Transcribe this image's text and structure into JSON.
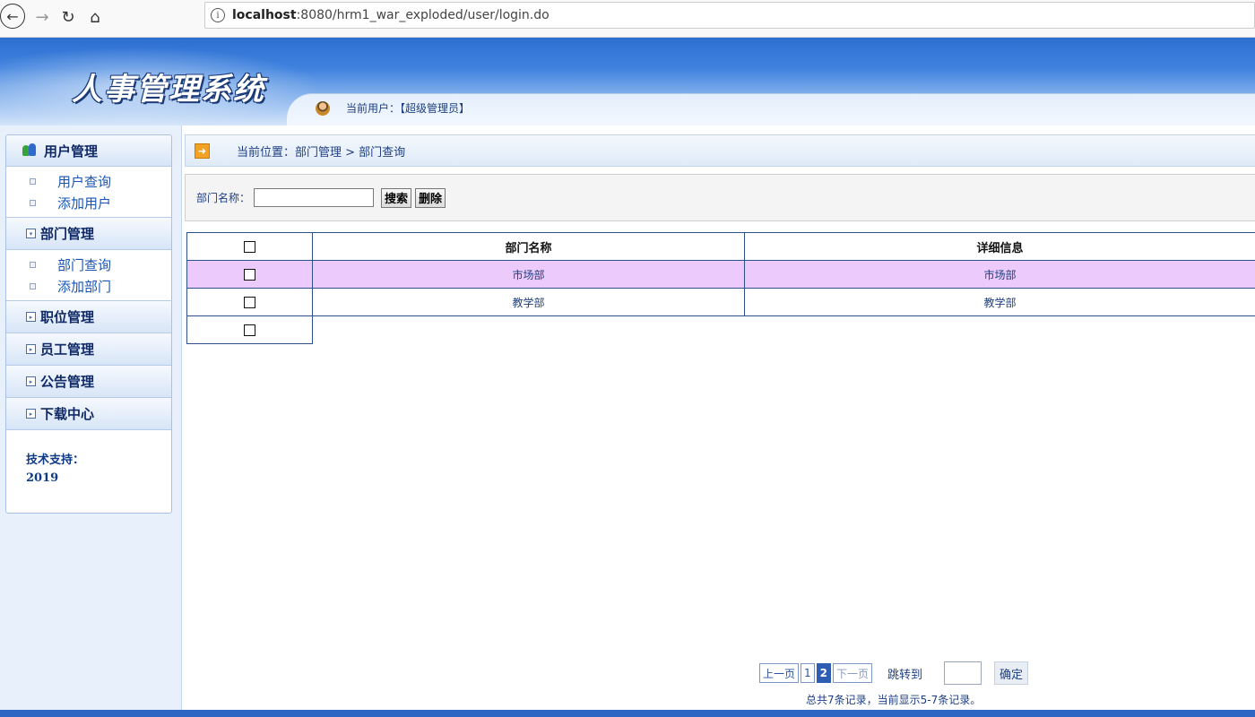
{
  "browser": {
    "url_host": "localhost",
    "url_path": ":8080/hrm1_war_exploded/user/login.do"
  },
  "header": {
    "app_title": "人事管理系统",
    "current_user": "当前用户：【超级管理员】"
  },
  "sidebar": {
    "groups": [
      {
        "label": "用户管理",
        "items": [
          "用户查询",
          "添加用户"
        ]
      },
      {
        "label": "部门管理",
        "items": [
          "部门查询",
          "添加部门"
        ]
      },
      {
        "label": "职位管理"
      },
      {
        "label": "员工管理"
      },
      {
        "label": "公告管理"
      },
      {
        "label": "下载中心"
      }
    ],
    "support_label": "技术支持：",
    "support_year": "2019"
  },
  "breadcrumb": "当前位置：部门管理 > 部门查询",
  "search": {
    "label": "部门名称：",
    "value": "",
    "search_btn": "搜索",
    "delete_btn": "删除"
  },
  "table": {
    "columns": [
      "部门名称",
      "详细信息"
    ],
    "rows": [
      {
        "name": "市场部",
        "detail": "市场部"
      },
      {
        "name": "教学部",
        "detail": "教学部"
      }
    ]
  },
  "pager": {
    "prev": "上一页",
    "pages": [
      "1",
      "2"
    ],
    "current": "2",
    "next": "下一页",
    "jump_label": "跳转到",
    "jump_value": "",
    "confirm": "确定",
    "summary": "总共7条记录，当前显示5-7条记录。"
  },
  "colors": {
    "banner": "#3f82de",
    "selected_row": "#eccafb",
    "link": "#1f3f82"
  }
}
